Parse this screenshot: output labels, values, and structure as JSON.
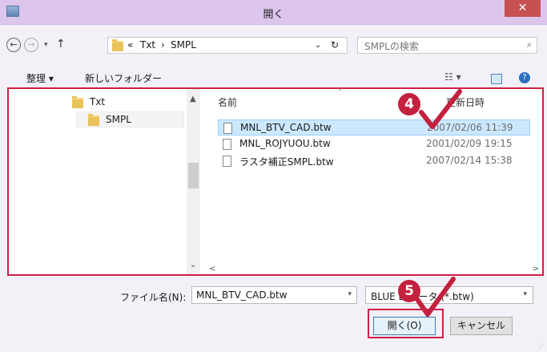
{
  "window": {
    "title": "開く",
    "close_label": "✕"
  },
  "address": {
    "crumbs": [
      "«",
      "Txt",
      "›",
      "SMPL"
    ],
    "refresh": "↻",
    "dropdown": "⌄"
  },
  "search": {
    "placeholder": "SMPLの検索",
    "icon": "⌕"
  },
  "toolbar": {
    "organize_label": "整理 ▾",
    "new_folder_label": "新しいフォルダー",
    "view_label": "☷ ▾",
    "help_label": "?"
  },
  "nav_tree": [
    {
      "label": "Txt"
    },
    {
      "label": "SMPL"
    }
  ],
  "file_list": {
    "columns": {
      "name": "名前",
      "date": "更新日時"
    },
    "rows": [
      {
        "name": "MNL_BTV_CAD.btw",
        "date": "2007/02/06 11:39",
        "selected": true
      },
      {
        "name": "MNL_ROJYUOU.btw",
        "date": "2001/02/09 19:15"
      },
      {
        "name": "ラスタ補正SMPL.btw",
        "date": "2007/02/14 15:38"
      }
    ]
  },
  "footer": {
    "filename_label": "ファイル名(N):",
    "filename_value": "MNL_BTV_CAD.btw",
    "filetype_value": "BLUE D データ (*.btw)",
    "open_label": "開く(O)",
    "cancel_label": "キャンセル"
  },
  "annotations": {
    "step4": "4",
    "step5": "5",
    "accent_color": "#c4203f"
  }
}
